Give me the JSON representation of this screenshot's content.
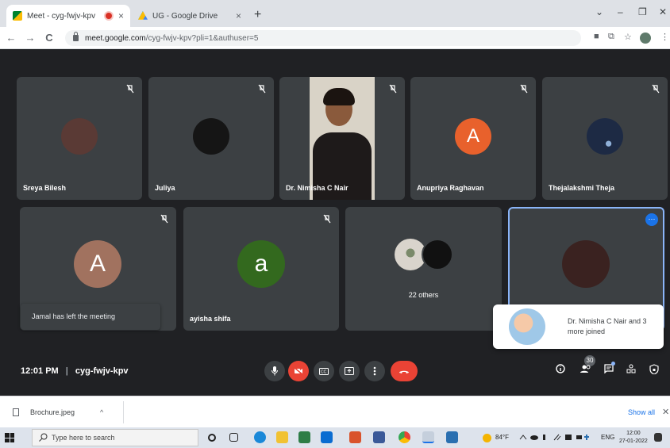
{
  "browser": {
    "tabs": [
      {
        "title": "Meet - cyg-fwjv-kpv",
        "close": "×",
        "icon": "meet-icon"
      },
      {
        "title": "UG - Google Drive",
        "close": "×",
        "icon": "drive-icon"
      }
    ],
    "new_tab": "+",
    "window_controls": [
      "⌄",
      "–",
      "❐",
      "✕"
    ],
    "url_host": "meet.google.com",
    "url_path": "/cyg-fwjv-kpv?pli=1&authuser=5",
    "nav": [
      "←",
      "→",
      "C"
    ],
    "toolbar_icons": [
      "■",
      "⧉",
      "☆",
      "⋮"
    ]
  },
  "meeting": {
    "participants_row1": [
      {
        "name": "Sreya Bilesh",
        "avatar_color": "#5a3a35"
      },
      {
        "name": "Juliya",
        "avatar_color": "#151515"
      },
      {
        "name": "Dr. Nimisha C Nair",
        "video": true
      },
      {
        "name": "Anupriya Raghavan",
        "initial": "A",
        "avatar_color": "#e8612c"
      },
      {
        "name": "Thejalakshmi Theja",
        "avatar_color": "#1d2a44"
      }
    ],
    "participants_row2": [
      {
        "name": "",
        "initial": "A",
        "avatar_color": "#a1725f"
      },
      {
        "name": "ayisha shifa",
        "initial": "a",
        "avatar_color": "#33691e"
      },
      {
        "name": "22 others"
      },
      {
        "name": "",
        "avatar_color": "#3a2220"
      }
    ],
    "toast": "Jamal has left the meeting",
    "joined_notice": "Dr. Nimisha C Nair and 3 more joined",
    "time": "12:01 PM",
    "separator": "|",
    "meeting_code": "cyg-fwjv-kpv",
    "people_count": "30",
    "more_options": "⋯",
    "accent": "#1a73e8",
    "danger": "#ea4335"
  },
  "downloads": {
    "file": "Brochure.jpeg",
    "caret": "^",
    "show_all": "Show all",
    "close": "✕"
  },
  "taskbar": {
    "search_placeholder": "Type here to search",
    "weather": "84°F",
    "language": "ENG",
    "time": "12:00",
    "date": "27-01-2022"
  }
}
